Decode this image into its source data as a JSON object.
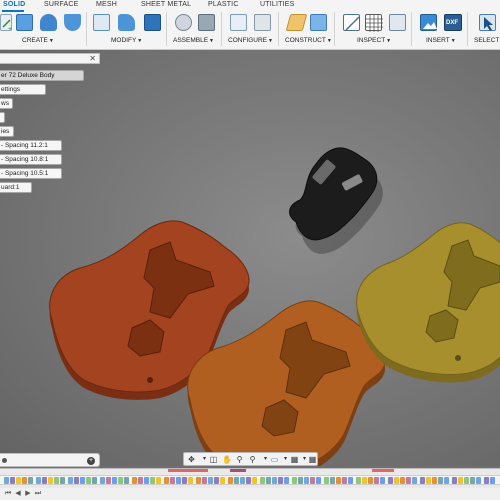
{
  "tabs": [
    {
      "label": "SOLID",
      "active": true
    },
    {
      "label": "SURFACE",
      "active": false
    },
    {
      "label": "MESH",
      "active": false
    },
    {
      "label": "SHEET METAL",
      "active": false
    },
    {
      "label": "PLASTIC",
      "active": false
    },
    {
      "label": "UTILITIES",
      "active": false
    }
  ],
  "groups": {
    "create": "CREATE",
    "modify": "MODIFY",
    "assemble": "ASSEMBLE",
    "configure": "CONFIGURE",
    "construct": "CONSTRUCT",
    "inspect": "INSPECT",
    "insert": "INSERT",
    "select": "SELECT"
  },
  "insert_dxf_text": "DXF",
  "browser": {
    "nodes": [
      "er 72 Deluxe Body",
      "ettings",
      "ws",
      "",
      "ies",
      "- Spacing 11.2:1",
      "- Spacing 10.8:1",
      "- Spacing 10.5:1",
      "uard:1"
    ]
  },
  "icons": {
    "browser_close": "close-icon",
    "comments": "comments-icon",
    "comments_add": "plus-icon"
  },
  "colors": {
    "accent": "#0a74c9",
    "body_red": "#a3431f",
    "body_orange": "#b15f20",
    "body_yellow": "#a78f2d",
    "pickguard": "#1b1b1b"
  }
}
